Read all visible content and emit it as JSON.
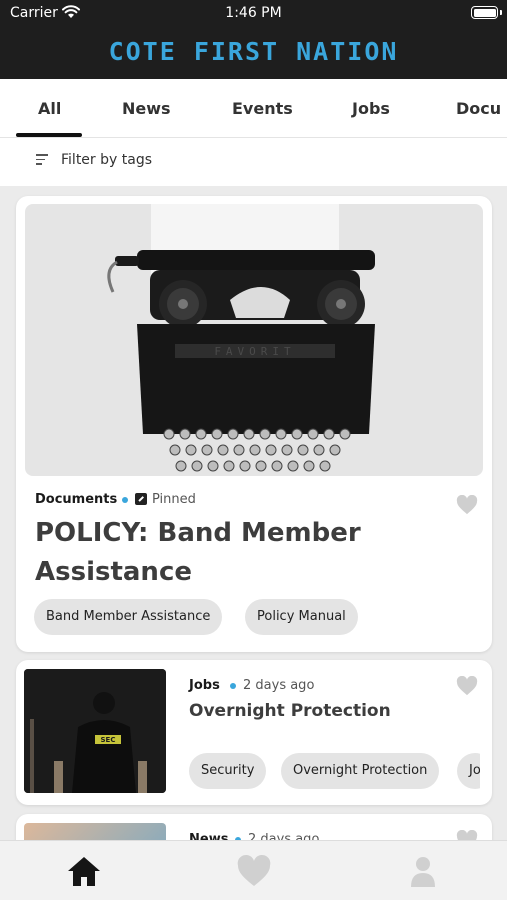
{
  "status_bar": {
    "carrier": "Carrier",
    "time": "1:46 PM"
  },
  "app": {
    "title": "COTE FIRST NATION",
    "accent_color": "#3aa6dc"
  },
  "tabs": [
    {
      "label": "All",
      "active": true
    },
    {
      "label": "News",
      "active": false
    },
    {
      "label": "Events",
      "active": false
    },
    {
      "label": "Jobs",
      "active": false
    },
    {
      "label": "Docu",
      "active": false
    }
  ],
  "filter": {
    "label": "Filter by tags",
    "icon": "filter-icon"
  },
  "feed": [
    {
      "category": "Documents",
      "meta": "Pinned",
      "meta_icon": "pin-icon",
      "title": "POLICY: Band Member Assistance",
      "tags": [
        "Band Member Assistance",
        "Policy Manual"
      ],
      "image": "typewriter",
      "favorited": false
    },
    {
      "category": "Jobs",
      "meta": "2 days ago",
      "title": "Overnight Protection",
      "tags": [
        "Security",
        "Overnight Protection",
        "Jo"
      ],
      "image": "security-guard",
      "favorited": false
    },
    {
      "category": "News",
      "meta": "2 days ago",
      "favorited": false
    }
  ],
  "bottom_nav": [
    {
      "icon": "home-icon",
      "active": true
    },
    {
      "icon": "heart-icon",
      "active": false
    },
    {
      "icon": "profile-icon",
      "active": false
    }
  ]
}
